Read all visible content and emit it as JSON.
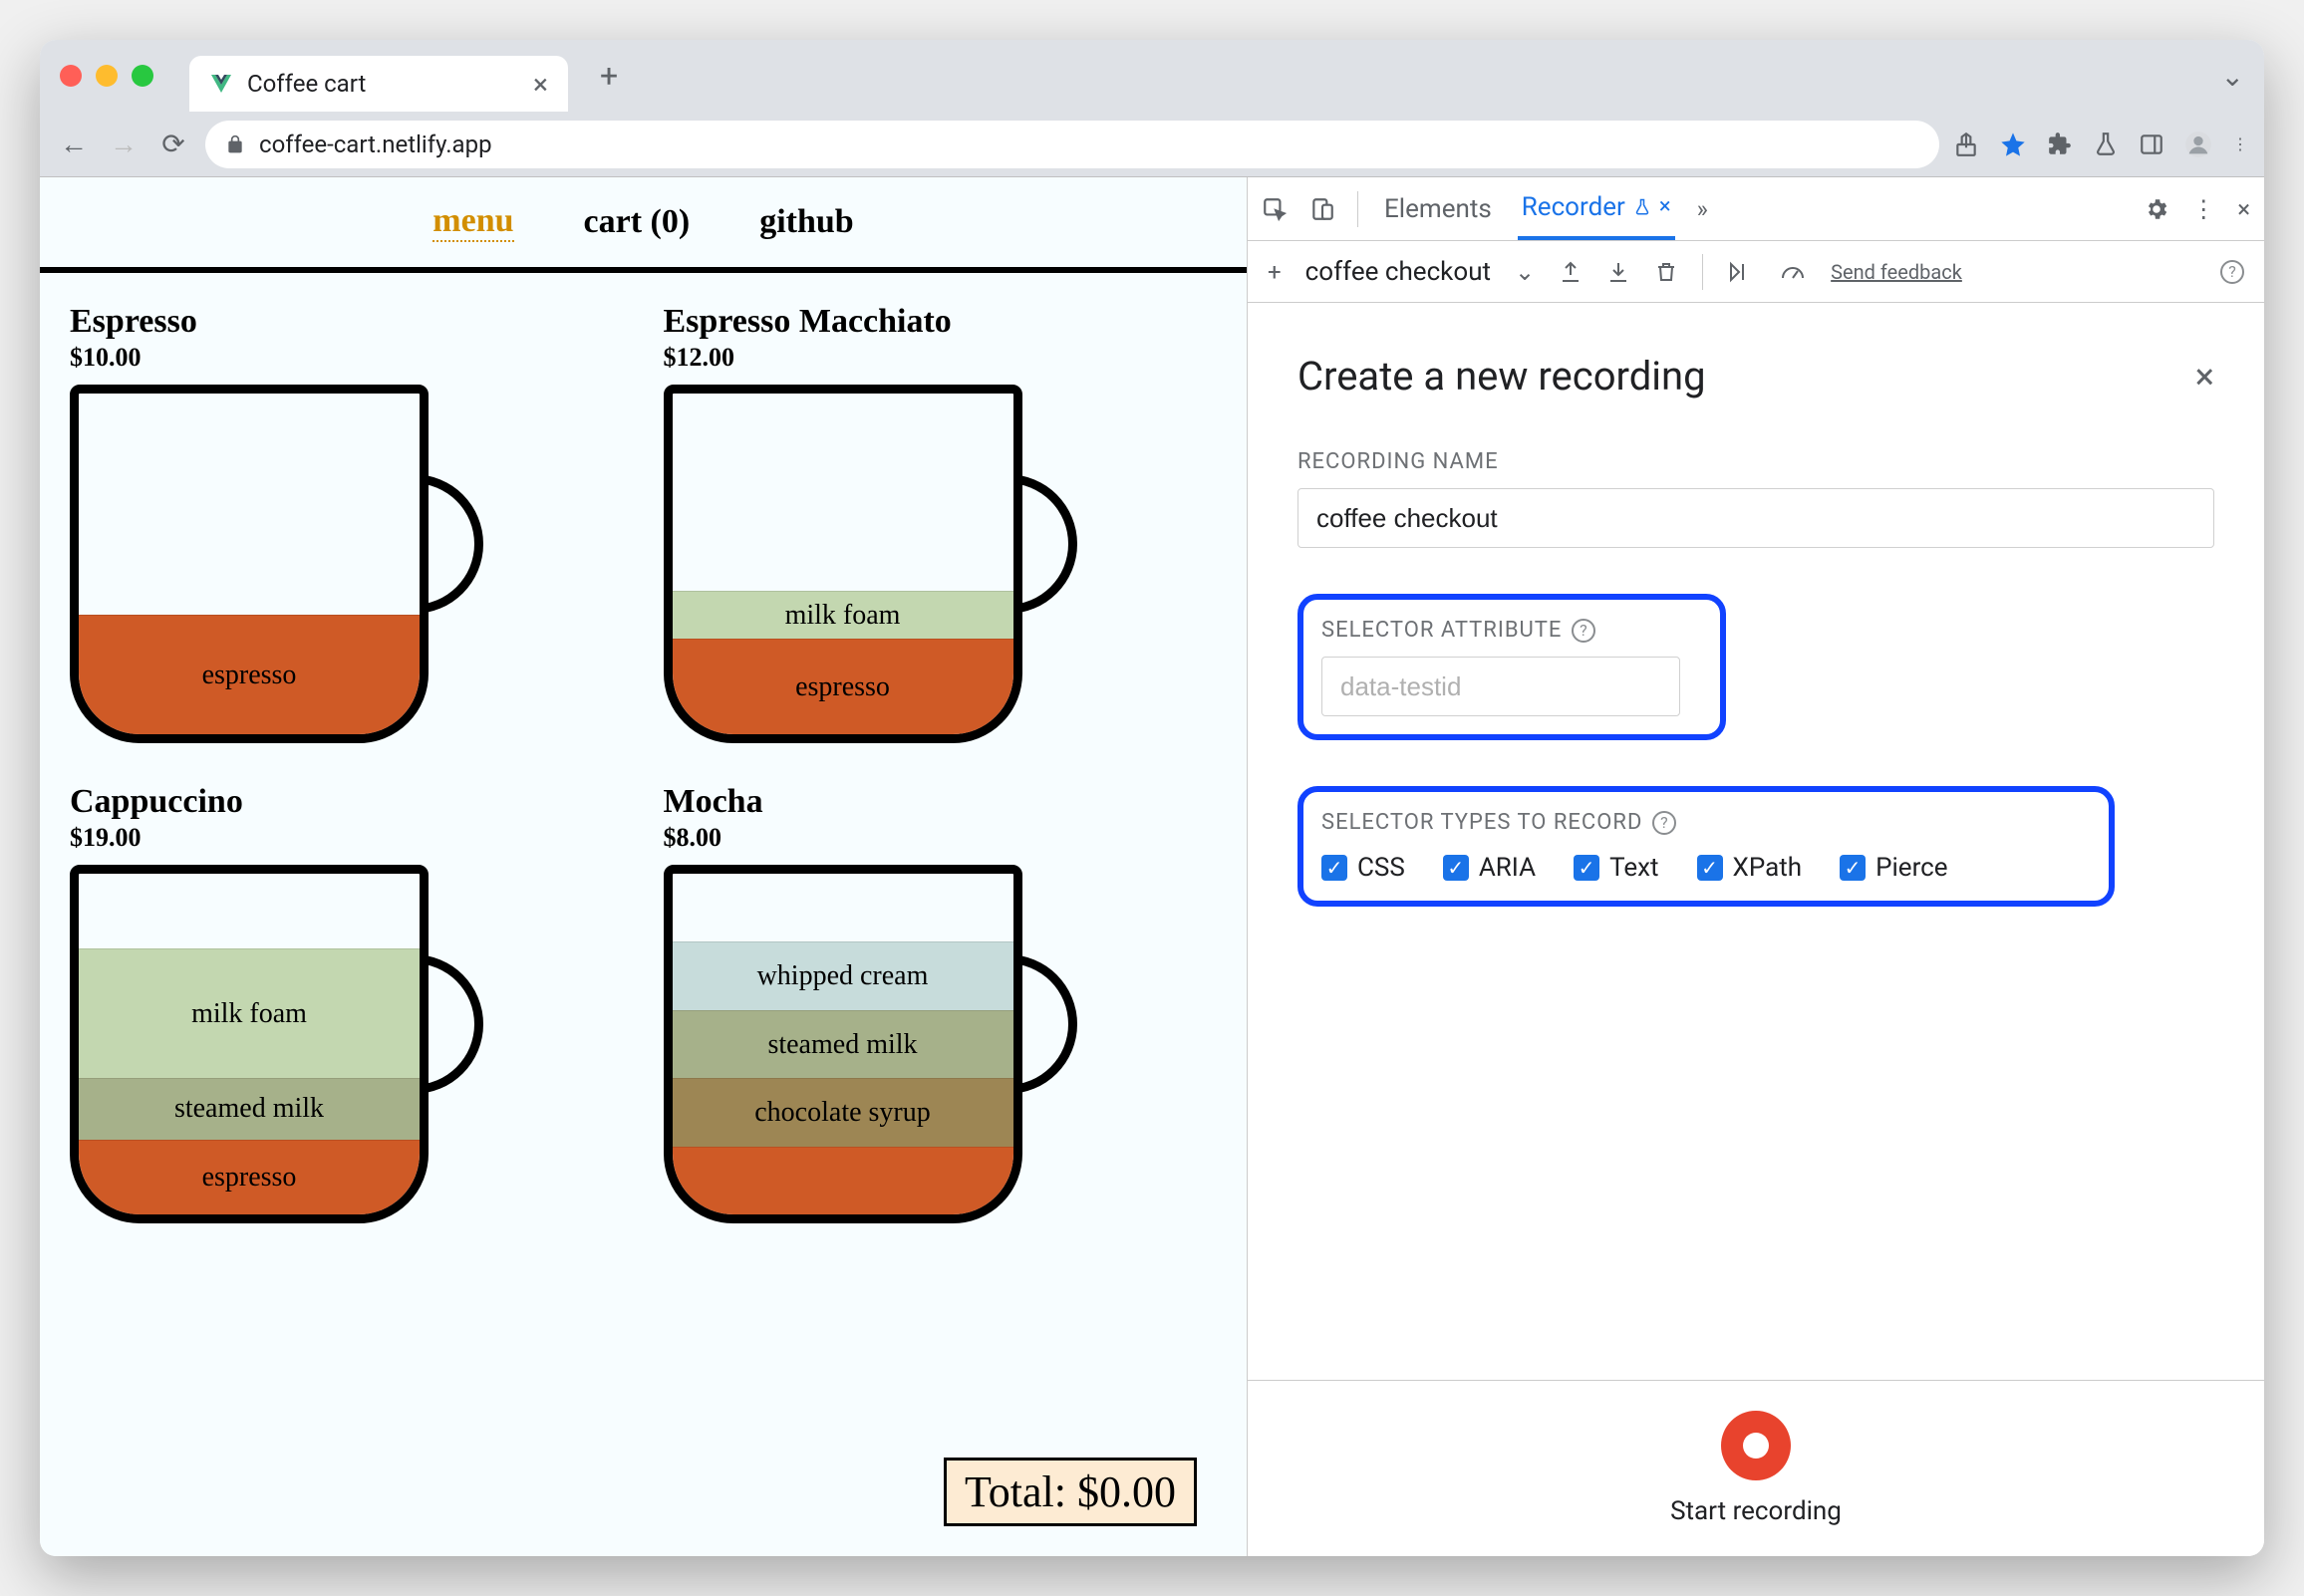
{
  "browser": {
    "tab_title": "Coffee cart",
    "url": "coffee-cart.netlify.app"
  },
  "page": {
    "nav": {
      "menu": "menu",
      "cart": "cart (0)",
      "github": "github"
    },
    "products": [
      {
        "name": "Espresso",
        "price": "$10.00"
      },
      {
        "name": "Espresso Macchiato",
        "price": "$12.00"
      },
      {
        "name": "Cappuccino",
        "price": "$19.00"
      },
      {
        "name": "Mocha",
        "price": "$8.00"
      }
    ],
    "layers": {
      "espresso": "espresso",
      "milk_foam": "milk foam",
      "steamed_milk": "steamed milk",
      "whipped_cream": "whipped cream",
      "chocolate_syrup": "chocolate syrup"
    },
    "total": "Total: $0.00"
  },
  "devtools": {
    "tabs": {
      "elements": "Elements",
      "recorder": "Recorder"
    },
    "recording_dropdown": "coffee checkout",
    "feedback": "Send feedback",
    "panel": {
      "title": "Create a new recording",
      "name_label": "RECORDING NAME",
      "name_value": "coffee checkout",
      "selector_attr_label": "SELECTOR ATTRIBUTE",
      "selector_attr_placeholder": "data-testid",
      "selector_types_label": "SELECTOR TYPES TO RECORD",
      "types": {
        "css": "CSS",
        "aria": "ARIA",
        "text": "Text",
        "xpath": "XPath",
        "pierce": "Pierce"
      },
      "start": "Start recording"
    }
  }
}
